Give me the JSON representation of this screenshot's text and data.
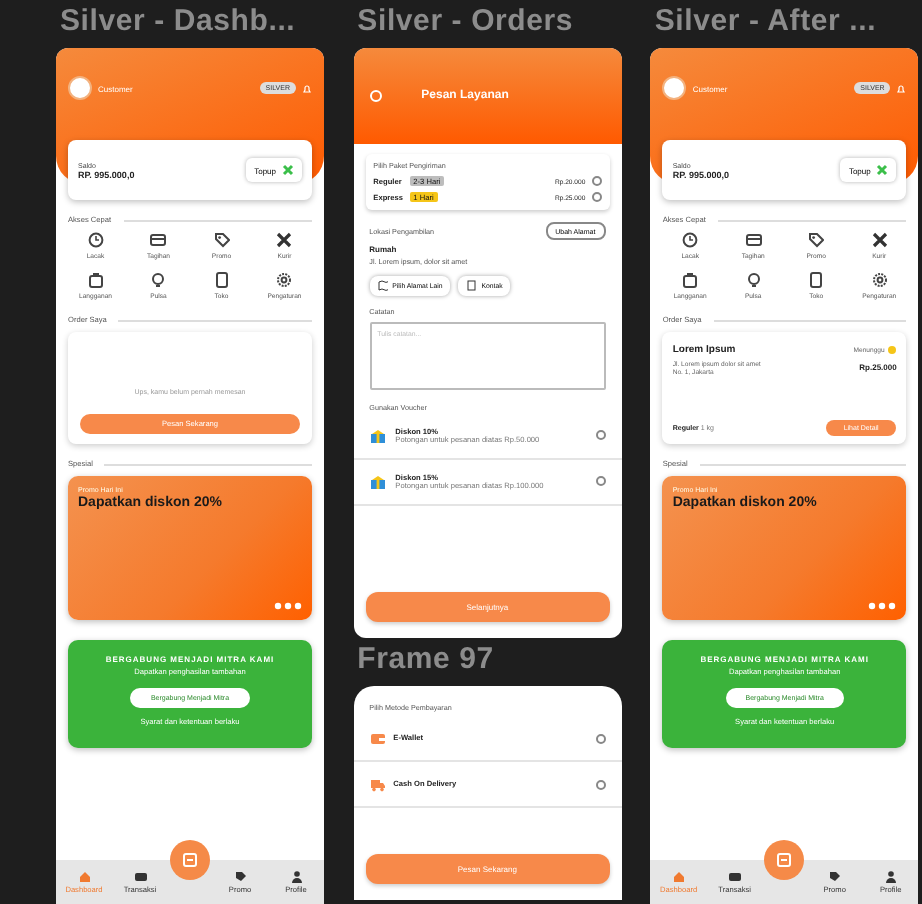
{
  "columns": [
    {
      "frames": [
        {
          "kind": "dashboard",
          "title": "Silver - Dashb...",
          "user": "Customer",
          "badge": "SILVER",
          "balance_label": "Saldo",
          "balance": "RP. 995.000,0",
          "topup": "Topup",
          "quick_title": "Akses Cepat",
          "quick": [
            "Lacak",
            "Tagihan",
            "Promo",
            "Kurir",
            "Langganan",
            "Pulsa",
            "Toko",
            "Pengaturan"
          ],
          "orders_title": "Order Saya",
          "order": {
            "kind": "empty",
            "text": "Ups, kamu belum pernah memesan",
            "button": "Pesan Sekarang"
          },
          "special_title": "Spesial",
          "promo": {
            "subtitle": "Promo Hari Ini",
            "title": "Dapatkan diskon 20%"
          },
          "partner": {
            "title": "BERGABUNG MENJADI MITRA KAMI",
            "subtitle": "Dapatkan penghasilan tambahan",
            "button": "Bergabung Menjadi Mitra",
            "note": "Syarat dan ketentuan berlaku"
          },
          "nav": [
            {
              "label": "Dashboard",
              "selected": true
            },
            {
              "label": "Transaksi",
              "selected": false
            },
            {
              "label": "Promo",
              "selected": false
            },
            {
              "label": "Profile",
              "selected": false
            }
          ]
        }
      ]
    },
    {
      "frames": [
        {
          "kind": "orders",
          "title": "Silver - Orders",
          "header": "Pesan Layanan",
          "package_title": "Pilih Paket Pengiriman",
          "packages": [
            {
              "name": "Reguler",
              "badge": "2-3 Hari",
              "color": "#bdbdbd",
              "price": "Rp.20.000",
              "selected": false
            },
            {
              "name": "Express",
              "badge": "1 Hari",
              "color": "#f5c518",
              "price": "Rp.25.000",
              "selected": false
            }
          ],
          "location_title": "Lokasi Pengambilan",
          "change_button": "Ubah Alamat",
          "place": "Rumah",
          "address": "Jl. Lorem ipsum, dolor sit amet",
          "chips": [
            "Pilih Alamat Lain",
            "Kontak"
          ],
          "note_title": "Catatan",
          "note_placeholder": "Tulis catatan...",
          "voucher_title": "Gunakan Voucher",
          "vouchers": [
            {
              "name": "Diskon 10%",
              "desc": "Potongan untuk pesanan diatas Rp.50.000",
              "selected": false
            },
            {
              "name": "Diskon 15%",
              "desc": "Potongan untuk pesanan diatas Rp.100.000",
              "selected": false
            }
          ],
          "button": "Selanjutnya"
        },
        {
          "kind": "payment",
          "title": "Frame 97",
          "method_title": "Pilih Metode Pembayaran",
          "methods": [
            {
              "kind": "wallet",
              "label": "E-Wallet",
              "selected": false
            },
            {
              "kind": "cash",
              "label": "Cash On Delivery",
              "selected": false
            }
          ],
          "button": "Pesan Sekarang"
        }
      ]
    },
    {
      "frames": [
        {
          "kind": "dashboard",
          "title": "Silver - After ...",
          "user": "Customer",
          "badge": "SILVER",
          "balance_label": "Saldo",
          "balance": "RP. 995.000,0",
          "topup": "Topup",
          "quick_title": "Akses Cepat",
          "quick": [
            "Lacak",
            "Tagihan",
            "Promo",
            "Kurir",
            "Langganan",
            "Pulsa",
            "Toko",
            "Pengaturan"
          ],
          "orders_title": "Order Saya",
          "order": {
            "kind": "active",
            "title": "Lorem Ipsum",
            "status": "Menunggu",
            "color": "#f5c518",
            "address": "Jl. Lorem ipsum dolor sit amet",
            "address2": "No. 1, Jakarta",
            "price": "Rp.25.000",
            "service_label": "Reguler",
            "service": "1 kg",
            "button": "Lihat Detail"
          },
          "special_title": "Spesial",
          "promo": {
            "subtitle": "Promo Hari Ini",
            "title": "Dapatkan diskon 20%"
          },
          "partner": {
            "title": "BERGABUNG MENJADI MITRA KAMI",
            "subtitle": "Dapatkan penghasilan tambahan",
            "button": "Bergabung Menjadi Mitra",
            "note": "Syarat dan ketentuan berlaku"
          },
          "nav": [
            {
              "label": "Dashboard",
              "selected": true
            },
            {
              "label": "Transaksi",
              "selected": false
            },
            {
              "label": "Promo",
              "selected": false
            },
            {
              "label": "Profile",
              "selected": false
            }
          ]
        }
      ]
    }
  ]
}
